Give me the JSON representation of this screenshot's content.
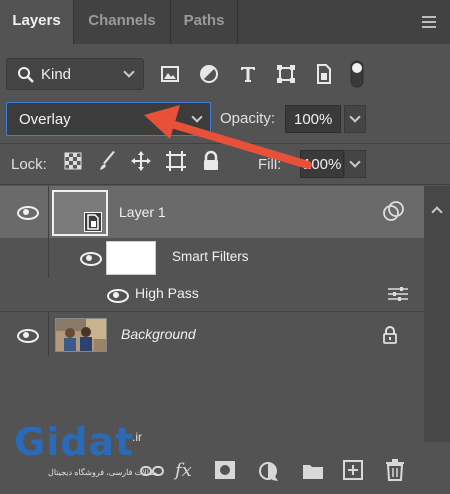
{
  "tabs": [
    "Layers",
    "Channels",
    "Paths"
  ],
  "filter": {
    "kind_label": "Kind",
    "icons": [
      "image-filter-icon",
      "adjustment-filter-icon",
      "type-filter-icon",
      "shape-filter-icon",
      "smart-object-filter-icon",
      "filter-toggle-icon"
    ]
  },
  "blend": {
    "mode": "Overlay",
    "opacity_label": "Opacity:",
    "opacity_value": "100%"
  },
  "lock": {
    "label": "Lock:",
    "icons": [
      "lock-transparent-icon",
      "lock-image-icon",
      "lock-position-icon",
      "lock-artboard-icon",
      "lock-all-icon"
    ],
    "fill_label": "Fill:",
    "fill_value": "100%"
  },
  "layers": [
    {
      "name": "Layer 1",
      "type": "smart-object",
      "visible": true,
      "selected": true
    },
    {
      "name": "Smart Filters",
      "type": "smart-filters",
      "visible": true
    },
    {
      "name": "High Pass",
      "type": "filter",
      "visible": true
    },
    {
      "name": "Background",
      "type": "background",
      "visible": true,
      "locked": true
    }
  ],
  "bottom_icons": [
    "link-layers-icon",
    "fx-icon",
    "add-mask-icon",
    "adjustment-layer-icon",
    "new-group-icon",
    "new-layer-icon",
    "delete-icon"
  ],
  "fx_label": "fx",
  "watermark": {
    "brand": "Gidat",
    "tld": ".ir",
    "tagline": "مقالات فارسی، فروشگاه دیجیتال"
  },
  "colors": {
    "accent": "#3d7fd6",
    "arrow": "#e8503a",
    "selected_row": "#6a6a6a"
  }
}
